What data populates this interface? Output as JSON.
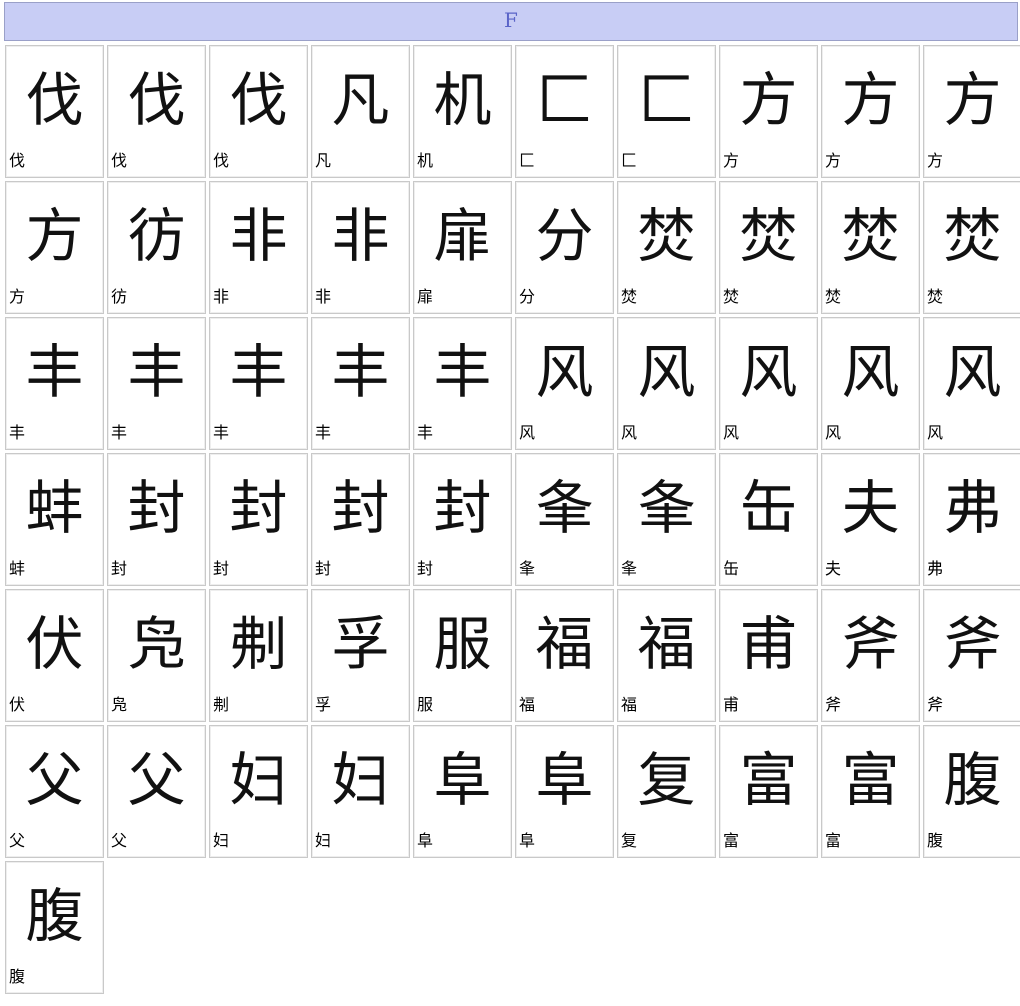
{
  "header": {
    "letter": "F"
  },
  "cells": [
    {
      "glyph": "伐",
      "label": "伐"
    },
    {
      "glyph": "伐",
      "label": "伐"
    },
    {
      "glyph": "伐",
      "label": "伐"
    },
    {
      "glyph": "凡",
      "label": "凡"
    },
    {
      "glyph": "机",
      "label": "机"
    },
    {
      "glyph": "匚",
      "label": "匚"
    },
    {
      "glyph": "匚",
      "label": "匚"
    },
    {
      "glyph": "方",
      "label": "方"
    },
    {
      "glyph": "方",
      "label": "方"
    },
    {
      "glyph": "方",
      "label": "方"
    },
    {
      "glyph": "方",
      "label": "方"
    },
    {
      "glyph": "彷",
      "label": "彷"
    },
    {
      "glyph": "非",
      "label": "非"
    },
    {
      "glyph": "非",
      "label": "非"
    },
    {
      "glyph": "扉",
      "label": "扉"
    },
    {
      "glyph": "分",
      "label": "分"
    },
    {
      "glyph": "焚",
      "label": "焚"
    },
    {
      "glyph": "焚",
      "label": "焚"
    },
    {
      "glyph": "焚",
      "label": "焚"
    },
    {
      "glyph": "焚",
      "label": "焚"
    },
    {
      "glyph": "丰",
      "label": "丰"
    },
    {
      "glyph": "丰",
      "label": "丰"
    },
    {
      "glyph": "丰",
      "label": "丰"
    },
    {
      "glyph": "丰",
      "label": "丰"
    },
    {
      "glyph": "丰",
      "label": "丰"
    },
    {
      "glyph": "风",
      "label": "风"
    },
    {
      "glyph": "风",
      "label": "风"
    },
    {
      "glyph": "风",
      "label": "风"
    },
    {
      "glyph": "风",
      "label": "风"
    },
    {
      "glyph": "风",
      "label": "风"
    },
    {
      "glyph": "蚌",
      "label": "蚌"
    },
    {
      "glyph": "封",
      "label": "封"
    },
    {
      "glyph": "封",
      "label": "封"
    },
    {
      "glyph": "封",
      "label": "封"
    },
    {
      "glyph": "封",
      "label": "封"
    },
    {
      "glyph": "夆",
      "label": "夆"
    },
    {
      "glyph": "夆",
      "label": "夆"
    },
    {
      "glyph": "缶",
      "label": "缶"
    },
    {
      "glyph": "夫",
      "label": "夫"
    },
    {
      "glyph": "弗",
      "label": "弗"
    },
    {
      "glyph": "伏",
      "label": "伏"
    },
    {
      "glyph": "凫",
      "label": "凫"
    },
    {
      "glyph": "刜",
      "label": "刜"
    },
    {
      "glyph": "孚",
      "label": "孚"
    },
    {
      "glyph": "服",
      "label": "服"
    },
    {
      "glyph": "福",
      "label": "福"
    },
    {
      "glyph": "福",
      "label": "福"
    },
    {
      "glyph": "甫",
      "label": "甫"
    },
    {
      "glyph": "斧",
      "label": "斧"
    },
    {
      "glyph": "斧",
      "label": "斧"
    },
    {
      "glyph": "父",
      "label": "父"
    },
    {
      "glyph": "父",
      "label": "父"
    },
    {
      "glyph": "妇",
      "label": "妇"
    },
    {
      "glyph": "妇",
      "label": "妇"
    },
    {
      "glyph": "阜",
      "label": "阜"
    },
    {
      "glyph": "阜",
      "label": "阜"
    },
    {
      "glyph": "复",
      "label": "复"
    },
    {
      "glyph": "富",
      "label": "富"
    },
    {
      "glyph": "富",
      "label": "富"
    },
    {
      "glyph": "腹",
      "label": "腹"
    },
    {
      "glyph": "腹",
      "label": "腹"
    }
  ]
}
